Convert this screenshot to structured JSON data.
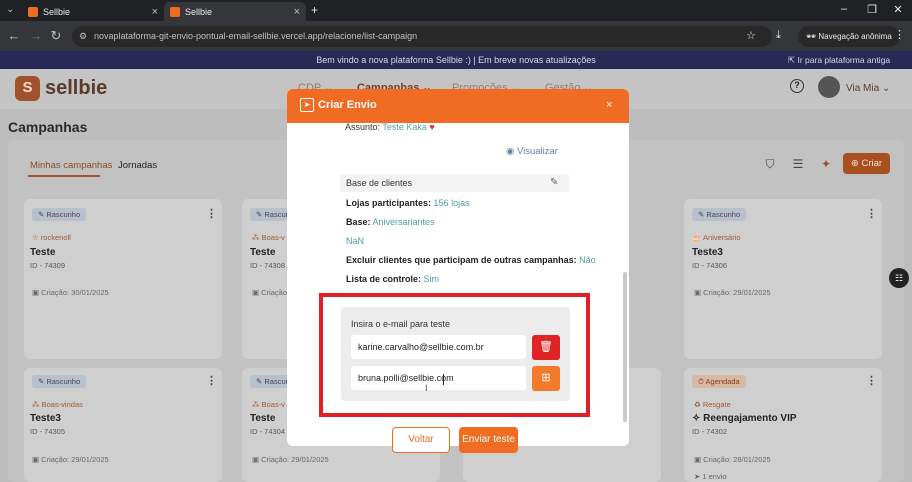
{
  "browser": {
    "tabs": [
      {
        "label": "Sellbie"
      },
      {
        "label": "Sellbie"
      }
    ],
    "url": "novaplataforma-git-envio-pontual-email-sellbie.vercel.app/relacione/list-campaign",
    "incognito_label": "Navegação anônima"
  },
  "banner": {
    "text": "Bem vindo a nova plataforma Sellbie :)   |   Em breve novas atualizações",
    "right_link": "Ir para plataforma antiga"
  },
  "header": {
    "logo_letter": "S",
    "logo_text": "sellbie",
    "menu": [
      "CDP",
      "Campanhas",
      "Promoções",
      "Gestão"
    ],
    "user_name": "Via Mia"
  },
  "page": {
    "title": "Campanhas",
    "subtabs": [
      "Minhas campanhas",
      "Jornadas"
    ],
    "create_label": "Criar"
  },
  "cards": [
    {
      "status": "Rascunho",
      "type": "rockenoll",
      "name": "Teste",
      "id": "ID - 74309",
      "date": "Criação: 30/01/2025"
    },
    {
      "status": "Rascunho",
      "type": "Boas-v",
      "name": "Teste",
      "id": "ID - 74308",
      "date": "Criação"
    },
    {
      "status": "Rascunho",
      "type": "Aniversário",
      "name": "Teste3",
      "id": "ID - 74306",
      "date": "Criação: 29/01/2025"
    },
    {
      "status": "Rascunho",
      "type": "Boas-vindas",
      "name": "Teste3",
      "id": "ID - 74305",
      "date": "Criação: 29/01/2025"
    },
    {
      "status": "Rascunho",
      "type": "Boas-v",
      "name": "Teste",
      "id": "ID - 74304",
      "date": "Criação: 29/01/2025"
    },
    {
      "status": "Agendada",
      "type": "Resgate",
      "name": "Reengajamento VIP",
      "id": "ID - 74302",
      "date": "Criação: 28/01/2025",
      "extra": "1 envio"
    }
  ],
  "modal": {
    "title": "Criar Envio",
    "close": "×",
    "subject_label": "Assunto:",
    "subject_value": "Teste Kaka",
    "view_label": "Visualizar",
    "base_header": "Base de clientes",
    "details": [
      {
        "k": "Lojas participantes:",
        "v": "156 lojas"
      },
      {
        "k": "Base:",
        "v": "Aniversariantes"
      },
      {
        "k": "",
        "v": "NaN"
      },
      {
        "k": "Excluir clientes que participam de outras campanhas:",
        "v": "Não"
      },
      {
        "k": "Lista de controle:",
        "v": "Sim"
      }
    ],
    "email_label": "Insira o e-mail para teste",
    "emails": [
      "karine.carvalho@sellbie.com.br",
      "bruna.polli@sellbie.com"
    ],
    "back_label": "Voltar",
    "send_label": "Enviar teste"
  }
}
